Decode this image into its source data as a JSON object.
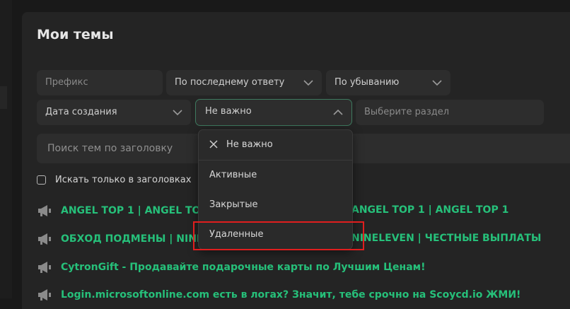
{
  "page": {
    "title": "Мои темы"
  },
  "filters": {
    "prefix_placeholder": "Префикс",
    "sort_by": "По последнему ответу",
    "order": "По убыванию",
    "date": "Дата создания",
    "status": "Не важно",
    "section_placeholder": "Выберите раздел"
  },
  "search": {
    "placeholder": "Поиск тем по заголовку"
  },
  "checkbox": {
    "label": "Искать только в заголовках",
    "checked": false
  },
  "status_dropdown": {
    "items": [
      "Не важно",
      "Активные",
      "Закрытые",
      "Удаленные"
    ],
    "selected": "Не важно",
    "highlighted": "Удаленные"
  },
  "threads": [
    {
      "left": "ANGEL TOP 1 | ANGEL TOP 1",
      "right": "ANGEL TOP 1 | ANGEL TOP 1"
    },
    {
      "left": "ОБХОД ПОДМЕНЫ | NINELE",
      "right": "NINELEVEN | ЧЕСТНЫЕ ВЫПЛАТЫ"
    },
    {
      "left": "CytronGift - Продавайте подарочные карты по Лучшим Ценам!",
      "right": ""
    },
    {
      "left": "Login.microsoftonline.com есть в логах? Значит, тебе срочно на Scoycd.io ЖМИ!",
      "right": ""
    }
  ],
  "colors": {
    "accent": "#26c07a",
    "highlight_box": "#e01e1e",
    "background": "#191919",
    "panel": "#242424"
  }
}
